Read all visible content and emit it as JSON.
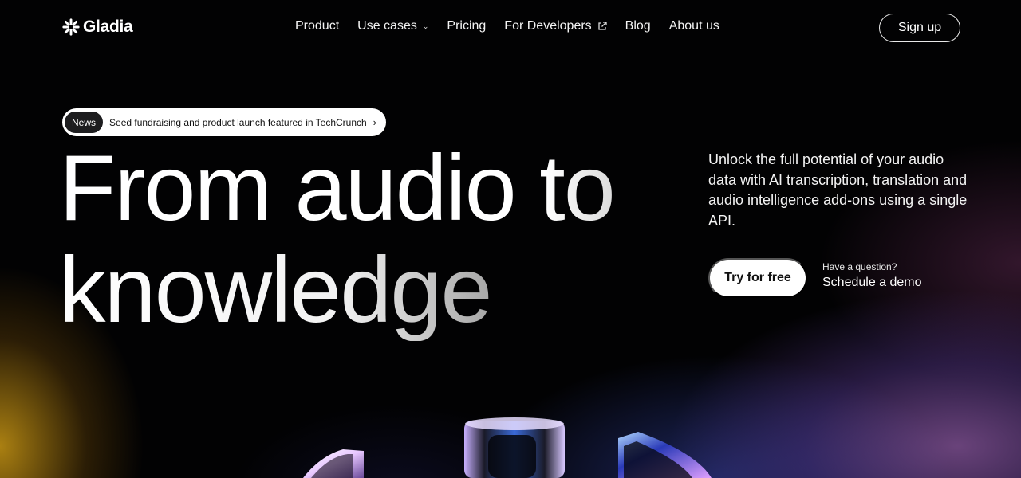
{
  "brand": {
    "name": "Gladia"
  },
  "nav": {
    "items": [
      {
        "label": "Product",
        "icon": ""
      },
      {
        "label": "Use cases",
        "icon": "chevron-down-icon"
      },
      {
        "label": "Pricing",
        "icon": ""
      },
      {
        "label": "For Developers",
        "icon": "external-link-icon"
      },
      {
        "label": "Blog",
        "icon": ""
      },
      {
        "label": "About us",
        "icon": ""
      }
    ],
    "signup_label": "Sign up"
  },
  "news": {
    "badge": "News",
    "text": "Seed fundraising and product launch featured in TechCrunch",
    "icon": "chevron-right-icon"
  },
  "hero": {
    "headline_line1": "From audio to",
    "headline_line2": "knowledge",
    "subtitle": "Unlock the full potential of your audio data with AI transcription, translation and audio intelligence add-ons using a single API.",
    "cta_label": "Try for free",
    "question_text": "Have a question?",
    "demo_link": "Schedule a demo"
  },
  "colors": {
    "background": "#020203",
    "accent_gold": "#c8961a",
    "accent_purple": "#be78dc",
    "accent_blue": "#3c50c8"
  }
}
